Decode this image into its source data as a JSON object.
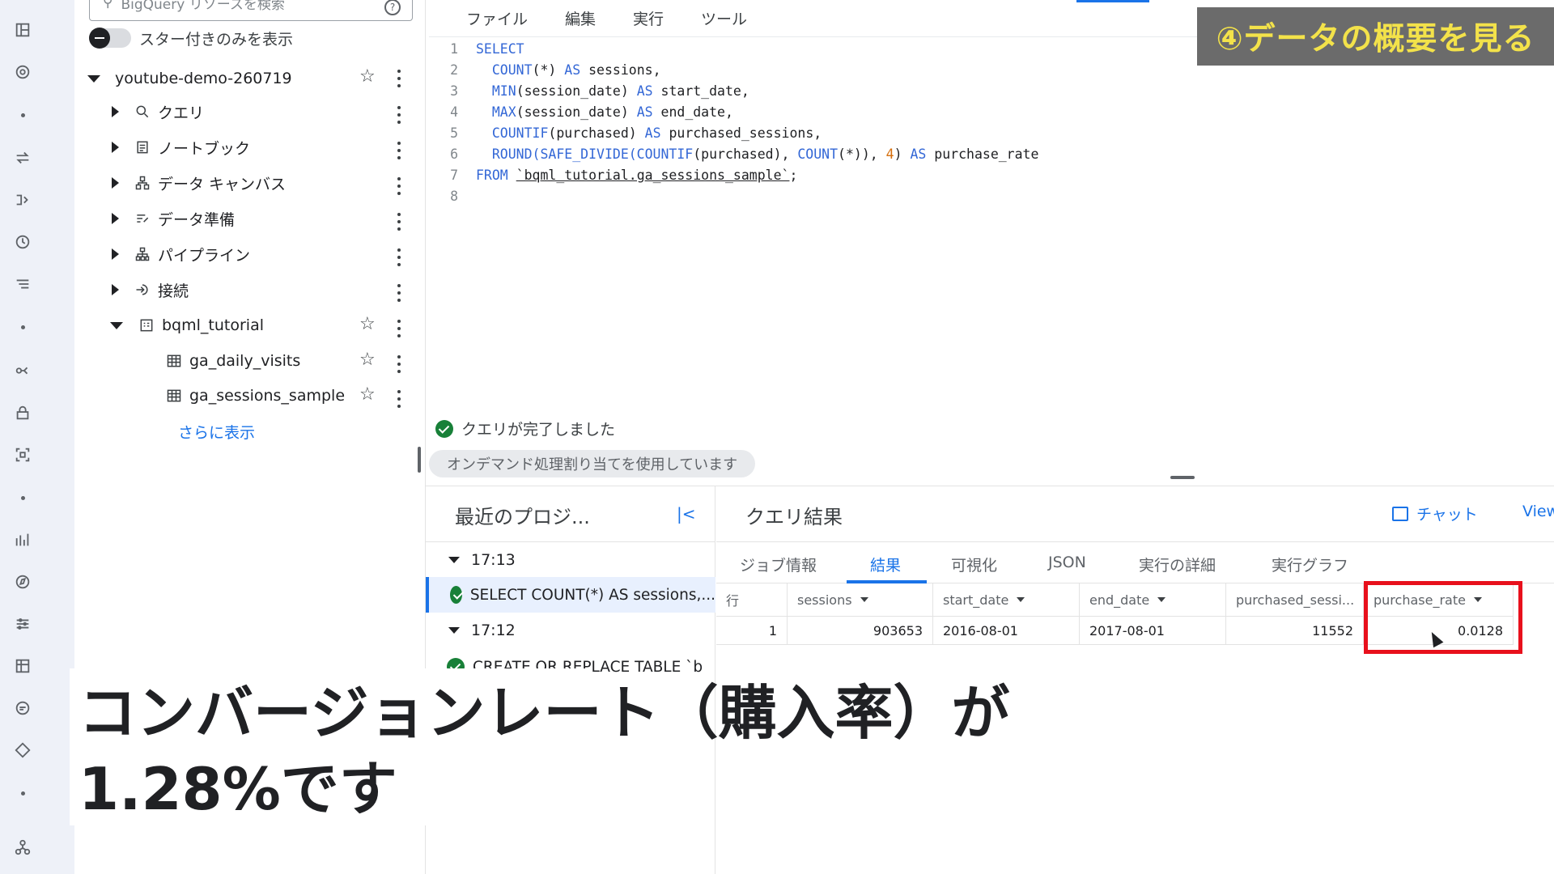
{
  "rail": {
    "icons": [
      "panels-icon",
      "compass-icon",
      "dot",
      "transfer-icon",
      "pipeline-icon",
      "history-icon",
      "list-icon",
      "dot",
      "graph-icon",
      "lock-icon",
      "scan-icon",
      "dot",
      "chart-icon",
      "explore-icon",
      "sliders-icon",
      "table-icon",
      "chat-icon",
      "diamond-icon",
      "dot",
      "hub-icon"
    ]
  },
  "explorer": {
    "search_placeholder": "BigQuery リソースを検索",
    "starred_only_label": "スター付きのみを表示",
    "project": "youtube-demo-260719",
    "nodes": [
      {
        "label": "クエリ"
      },
      {
        "label": "ノートブック"
      },
      {
        "label": "データ キャンバス"
      },
      {
        "label": "データ準備"
      },
      {
        "label": "パイプライン"
      },
      {
        "label": "接続"
      },
      {
        "label": "bqml_tutorial"
      }
    ],
    "tables": [
      {
        "label": "ga_daily_visits"
      },
      {
        "label": "ga_sessions_sample"
      }
    ],
    "show_more": "さらに表示"
  },
  "editor": {
    "menu": [
      "ファイル",
      "編集",
      "実行",
      "ツール"
    ],
    "lines": [
      "1",
      "2",
      "3",
      "4",
      "5",
      "6",
      "7",
      "8"
    ],
    "code": {
      "l1_kw": "SELECT",
      "l2_fn": "COUNT",
      "l2_rest": "(*) ",
      "l2_as": "AS",
      "l2_id": " sessions,",
      "l3_fn": "MIN",
      "l3_rest": "(session_date) ",
      "l3_as": "AS",
      "l3_id": " start_date,",
      "l4_fn": "MAX",
      "l4_rest": "(session_date) ",
      "l4_as": "AS",
      "l4_id": " end_date,",
      "l5_fn": "COUNTIF",
      "l5_rest": "(purchased) ",
      "l5_as": "AS",
      "l5_id": " purchased_sessions,",
      "l6_fn": "ROUND(SAFE_DIVIDE(COUNTIF",
      "l6_a": "(purchased), ",
      "l6_fn2": "COUNT",
      "l6_b": "(*)), ",
      "l6_num": "4",
      "l6_c": ") ",
      "l6_as": "AS",
      "l6_id": " purchase_rate",
      "l7_kw": "FROM",
      "l7_str": "`bqml_tutorial.ga_sessions_sample`",
      "l7_end": ";"
    }
  },
  "status": {
    "done": "クエリが完了しました",
    "ondemand": "オンデマンド処理割り当てを使用しています"
  },
  "recent": {
    "title": "最近のプロジ...",
    "collapse": "|<",
    "groups": [
      {
        "time": "17:13",
        "job": "SELECT COUNT(*) AS sessions,..."
      },
      {
        "time": "17:12",
        "job": "CREATE OR REPLACE TABLE `b"
      }
    ]
  },
  "results": {
    "title": "クエリ結果",
    "chat": "チャット",
    "view": "View",
    "tabs": [
      "ジョブ情報",
      "結果",
      "可視化",
      "JSON",
      "実行の詳細",
      "実行グラフ"
    ],
    "active_tab": "結果",
    "columns": [
      "行",
      "sessions",
      "start_date",
      "end_date",
      "purchased_sessi...",
      "purchase_rate"
    ],
    "rows": [
      [
        "1",
        "903653",
        "2016-08-01",
        "2017-08-01",
        "11552",
        "0.0128"
      ]
    ]
  },
  "badge": "④データの概要を見る",
  "caption": "コンバージョンレート（購入率）が\n1.28%です",
  "colors": {
    "accent": "#1a73e8",
    "success": "#188038",
    "highlight": "#e8101c",
    "badge_bg": "#6b6b6b",
    "badge_text": "#f3e24a"
  }
}
